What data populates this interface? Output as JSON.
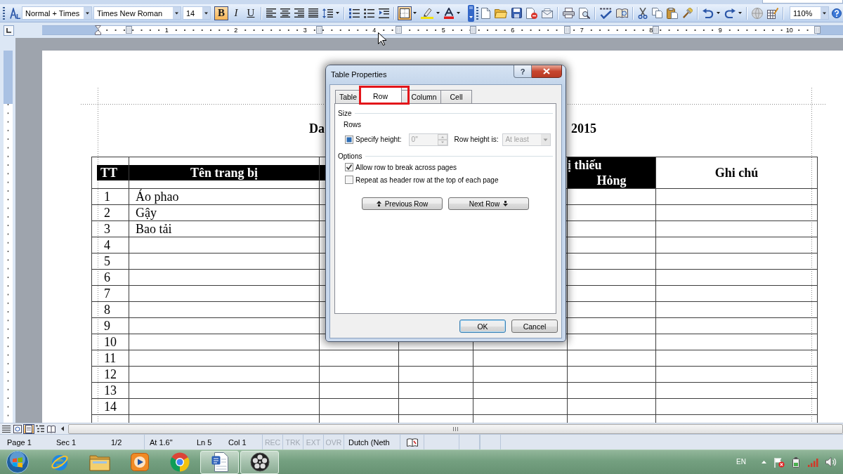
{
  "toolbar": {
    "style": "Normal + Times",
    "font": "Times New Roman",
    "size": "14",
    "text_buttons": [
      {
        "label": "B",
        "on": true
      },
      {
        "label": "I",
        "on": false
      },
      {
        "label": "U",
        "on": false
      }
    ],
    "borders": {
      "on": true
    },
    "zoom": "110%"
  },
  "ruler": {
    "numbers": [
      "1",
      "2",
      "3",
      "4",
      "5",
      "6",
      "7",
      "8",
      "9",
      "10"
    ]
  },
  "document": {
    "title_parts": [
      "Da",
      "2015"
    ],
    "table": {
      "columns": [
        {
          "lines": [
            "TT"
          ],
          "kind": "band"
        },
        {
          "lines": [
            "Tên trang bị"
          ],
          "kind": "band"
        },
        {
          "kind": "band"
        },
        {},
        {},
        {
          "lines": [
            "ị thiếu",
            "Hỏng"
          ],
          "kind": "filled"
        },
        {
          "lines": [
            "Ghi chú"
          ],
          "kind": "plain"
        }
      ],
      "rows": [
        [
          "1",
          "Áo phao"
        ],
        [
          "2",
          "Gậy"
        ],
        [
          "3",
          "Bao tải"
        ],
        [
          "4"
        ],
        [
          "5"
        ],
        [
          "6"
        ],
        [
          "7"
        ],
        [
          "8"
        ],
        [
          "9"
        ],
        [
          "10"
        ],
        [
          "11"
        ],
        [
          "12"
        ],
        [
          "13"
        ],
        [
          "14"
        ]
      ]
    }
  },
  "dialog": {
    "title": "Table Properties",
    "help_button": "?",
    "tabs": [
      {
        "label": "Table",
        "selected": false
      },
      {
        "label": "Row",
        "selected": true
      },
      {
        "label": "Column",
        "selected": false
      },
      {
        "label": "Cell",
        "selected": false
      }
    ],
    "size": {
      "heading": "Size",
      "subheading": "Rows",
      "specify_height": {
        "label": "Specify height:",
        "indeterminate": true
      },
      "height": {
        "value": "0\"",
        "disabled": true
      },
      "row_height_is": {
        "label": "Row height is:",
        "value": "At least",
        "disabled": true
      }
    },
    "options": {
      "heading": "Options",
      "items": [
        {
          "label": "Allow row to break across pages",
          "checked": true
        },
        {
          "label": "Repeat as header row at the top of each page",
          "checked": false
        }
      ]
    },
    "navigation": [
      {
        "label": "Previous Row",
        "kind": "previous"
      },
      {
        "label": "Next Row",
        "kind": "next"
      }
    ],
    "buttons": [
      {
        "label": "OK",
        "default": true
      },
      {
        "label": "Cancel",
        "default": false
      }
    ]
  },
  "views": [
    {
      "kind": "normal",
      "selected": false
    },
    {
      "kind": "web",
      "selected": false
    },
    {
      "kind": "print",
      "selected": true
    },
    {
      "kind": "outline",
      "selected": false
    },
    {
      "kind": "reading",
      "selected": false
    }
  ],
  "status_bar": {
    "position": [
      "Page 1",
      "Sec 1",
      "1/2"
    ],
    "cursor": [
      "At 1.6\"",
      "Ln 5",
      "Col 1"
    ],
    "modes": [
      {
        "label": "REC",
        "active": false
      },
      {
        "label": "TRK",
        "active": false
      },
      {
        "label": "EXT",
        "active": false
      },
      {
        "label": "OVR",
        "active": false
      }
    ],
    "language": "Dutch (Neth"
  },
  "taskbar": {
    "apps": [
      {
        "kind": "e-browser",
        "running": false
      },
      {
        "kind": "folder",
        "running": false
      },
      {
        "kind": "player",
        "running": false
      },
      {
        "kind": "ball-browser",
        "running": false
      },
      {
        "kind": "document",
        "running": true
      },
      {
        "kind": "reel",
        "running": true
      }
    ],
    "language": "EN"
  }
}
